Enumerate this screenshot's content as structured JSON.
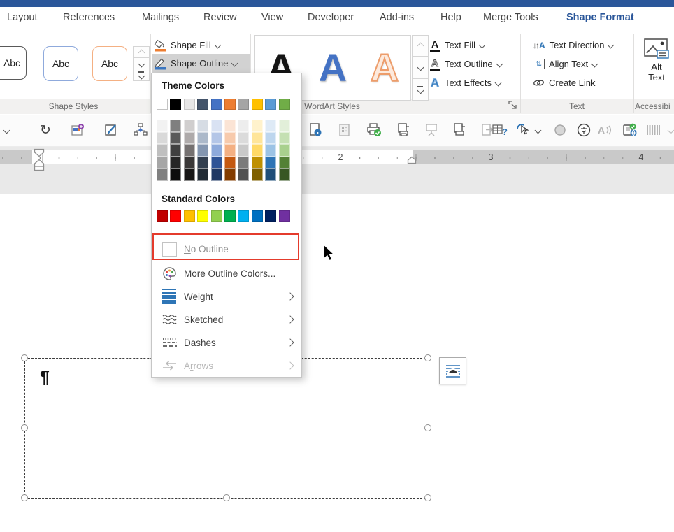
{
  "app": {
    "accent_color": "#2b579a"
  },
  "tabs": {
    "items": [
      "Layout",
      "References",
      "Mailings",
      "Review",
      "View",
      "Developer",
      "Add-ins",
      "Help",
      "Merge Tools",
      "Shape Format"
    ],
    "active": "Shape Format"
  },
  "ribbon": {
    "shape_styles": {
      "label": "Shape Styles",
      "samples": [
        "Abc",
        "Abc",
        "Abc"
      ]
    },
    "shape_fill": "Shape Fill",
    "shape_outline": "Shape Outline",
    "wordart": {
      "label": "WordArt Styles",
      "letters": [
        "A",
        "A",
        "A"
      ]
    },
    "text_fill": "Text Fill",
    "text_outline": "Text Outline",
    "text_effects": "Text Effects",
    "text_group": {
      "label": "Text",
      "text_direction": "Text Direction",
      "align_text": "Align Text",
      "create_link": "Create Link"
    },
    "accessibility": {
      "label": "Accessibi",
      "alt_line1": "Alt",
      "alt_line2": "Text"
    }
  },
  "menu": {
    "theme_colors_label": "Theme Colors",
    "standard_colors_label": "Standard Colors",
    "theme_colors": [
      "#FFFFFF",
      "#000000",
      "#E7E6E6",
      "#44546A",
      "#4472C4",
      "#ED7D31",
      "#A5A5A5",
      "#FFC000",
      "#5B9BD5",
      "#70AD47"
    ],
    "theme_variants": [
      [
        "#F2F2F2",
        "#7F7F7F",
        "#D0CECE",
        "#D6DCE4",
        "#D9E2F3",
        "#FBE4D5",
        "#EDEDED",
        "#FFF2CC",
        "#DEEAF6",
        "#E2EFD9"
      ],
      [
        "#D9D9D9",
        "#595959",
        "#AEAAAA",
        "#ACB9CA",
        "#B4C6E7",
        "#F7CAAC",
        "#DBDBDB",
        "#FFE599",
        "#BDD6EE",
        "#C5E0B3"
      ],
      [
        "#BFBFBF",
        "#404040",
        "#757171",
        "#8496B0",
        "#8EAADB",
        "#F4B083",
        "#C9C9C9",
        "#FFD966",
        "#9CC3E5",
        "#A8D08D"
      ],
      [
        "#A6A6A6",
        "#262626",
        "#3A3838",
        "#333F4F",
        "#2F5496",
        "#C45911",
        "#7B7B7B",
        "#BF9000",
        "#2E74B5",
        "#538135"
      ],
      [
        "#808080",
        "#0D0D0D",
        "#171616",
        "#222B35",
        "#1F3864",
        "#833C00",
        "#525252",
        "#7F6000",
        "#1F4E79",
        "#375623"
      ]
    ],
    "standard_colors": [
      "#C00000",
      "#FF0000",
      "#FFC000",
      "#FFFF00",
      "#92D050",
      "#00B050",
      "#00B0F0",
      "#0070C0",
      "#002060",
      "#7030A0"
    ],
    "items": {
      "no_outline": {
        "pre": "",
        "key": "N",
        "post": "o Outline"
      },
      "more_colors": {
        "pre": "",
        "key": "M",
        "post": "ore Outline Colors..."
      },
      "weight": {
        "pre": "",
        "key": "W",
        "post": "eight"
      },
      "sketched": {
        "pre": "S",
        "key": "k",
        "post": "etched"
      },
      "dashes": {
        "pre": "Da",
        "key": "s",
        "post": "hes"
      },
      "arrows": {
        "pre": "A",
        "key": "r",
        "post": "rows"
      }
    },
    "annotation": {
      "type": "highlight-box",
      "color": "#e43b2c",
      "target": "No Outline"
    }
  },
  "ruler": {
    "numbers": [
      "2",
      "3",
      "4"
    ]
  },
  "document": {
    "paragraph_mark": "¶"
  },
  "qat": {
    "icons": [
      "overflow-chevron-icon",
      "repeat-icon",
      "addin-icon",
      "form-edit-icon",
      "org-chart-icon",
      "table-icon",
      "doc-info-icon",
      "doc-properties-icon",
      "quick-print-icon",
      "print-preview-icon",
      "presentation-icon",
      "print-doc-icon",
      "doc-export-icon",
      "table-help-icon",
      "touch-mode-icon",
      "record-icon",
      "phonetic-guide-icon",
      "read-aloud-icon",
      "translate-icon",
      "barcode-icon"
    ]
  }
}
